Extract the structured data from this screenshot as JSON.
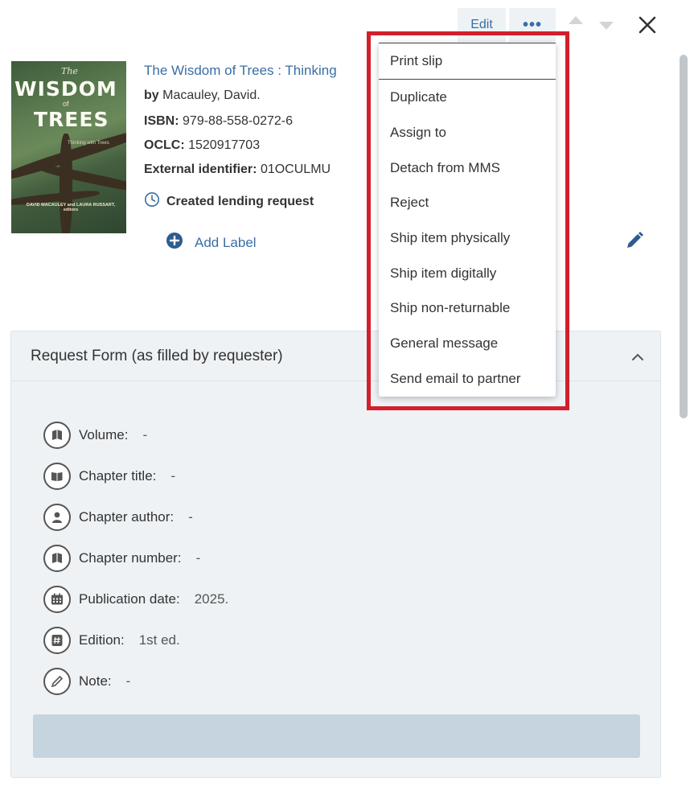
{
  "toolbar": {
    "edit_label": "Edit",
    "more_label": "•••",
    "icons": [
      "chevron-up-icon",
      "chevron-down-icon",
      "close-icon"
    ]
  },
  "record": {
    "cover": {
      "wisdom": "WISDOM",
      "trees": "TREES",
      "the": "The",
      "of": "of",
      "subtitle": "Thinking with Trees",
      "authors": "DAVID MACAULEY and LAURA RUSSART, editors"
    },
    "title": "The Wisdom of Trees : Thinking",
    "by_label": "by",
    "by_value": "Macauley, David.",
    "isbn_label": "ISBN:",
    "isbn_value": "979-88-558-0272-6",
    "oclc_label": "OCLC:",
    "oclc_value": "1520917703",
    "extid_label": "External identifier:",
    "extid_value": "01OCULMU",
    "status": "Created lending request",
    "add_label": "Add Label"
  },
  "request_form": {
    "title": "Request Form (as filled by requester)",
    "fields": [
      {
        "label": "Volume:",
        "value": "-",
        "icon": "book-icon"
      },
      {
        "label": "Chapter title:",
        "value": "-",
        "icon": "open-book-icon"
      },
      {
        "label": "Chapter author:",
        "value": "-",
        "icon": "person-icon"
      },
      {
        "label": "Chapter number:",
        "value": "-",
        "icon": "book-icon"
      },
      {
        "label": "Publication date:",
        "value": "2025.",
        "icon": "calendar-icon"
      },
      {
        "label": "Edition:",
        "value": "1st ed.",
        "icon": "hash-icon"
      },
      {
        "label": "Note:",
        "value": "-",
        "icon": "pencil-icon"
      }
    ]
  },
  "menu": {
    "items": [
      "Print slip",
      "Duplicate",
      "Assign to",
      "Detach from MMS",
      "Reject",
      "Ship item physically",
      "Ship item digitally",
      "Ship non-returnable",
      "General message",
      "Send email to partner"
    ]
  },
  "colors": {
    "accent": "#3a6ea5",
    "highlight": "#d21f2b",
    "panel_bg": "#eef2f5"
  }
}
